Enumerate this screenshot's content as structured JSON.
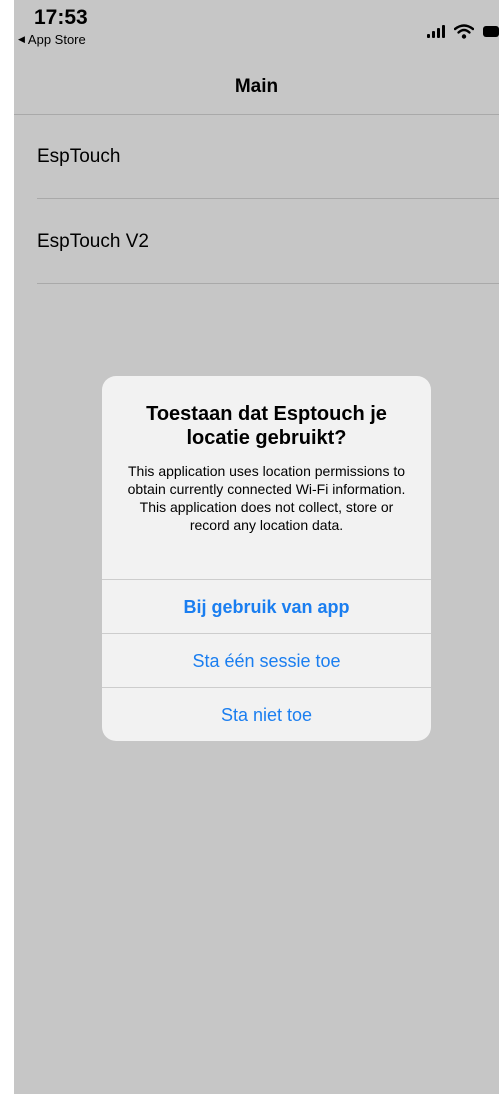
{
  "status_bar": {
    "time": "17:53",
    "back_app": "App Store",
    "icons": [
      "signal-icon",
      "wifi-icon",
      "battery-icon"
    ]
  },
  "nav": {
    "title": "Main"
  },
  "menu": [
    {
      "label": "EspTouch"
    },
    {
      "label": "EspTouch V2"
    }
  ],
  "alert": {
    "title": "Toestaan dat Esptouch je locatie gebruikt?",
    "message": "This application uses location permissions to obtain currently connected Wi-Fi information. This application does not collect, store or record any location data.",
    "buttons": [
      {
        "label": "Bij gebruik van app"
      },
      {
        "label": "Sta één sessie toe"
      },
      {
        "label": "Sta niet toe"
      }
    ]
  },
  "colors": {
    "accent": "#1a7ef0",
    "background": "#f2f2f2"
  }
}
